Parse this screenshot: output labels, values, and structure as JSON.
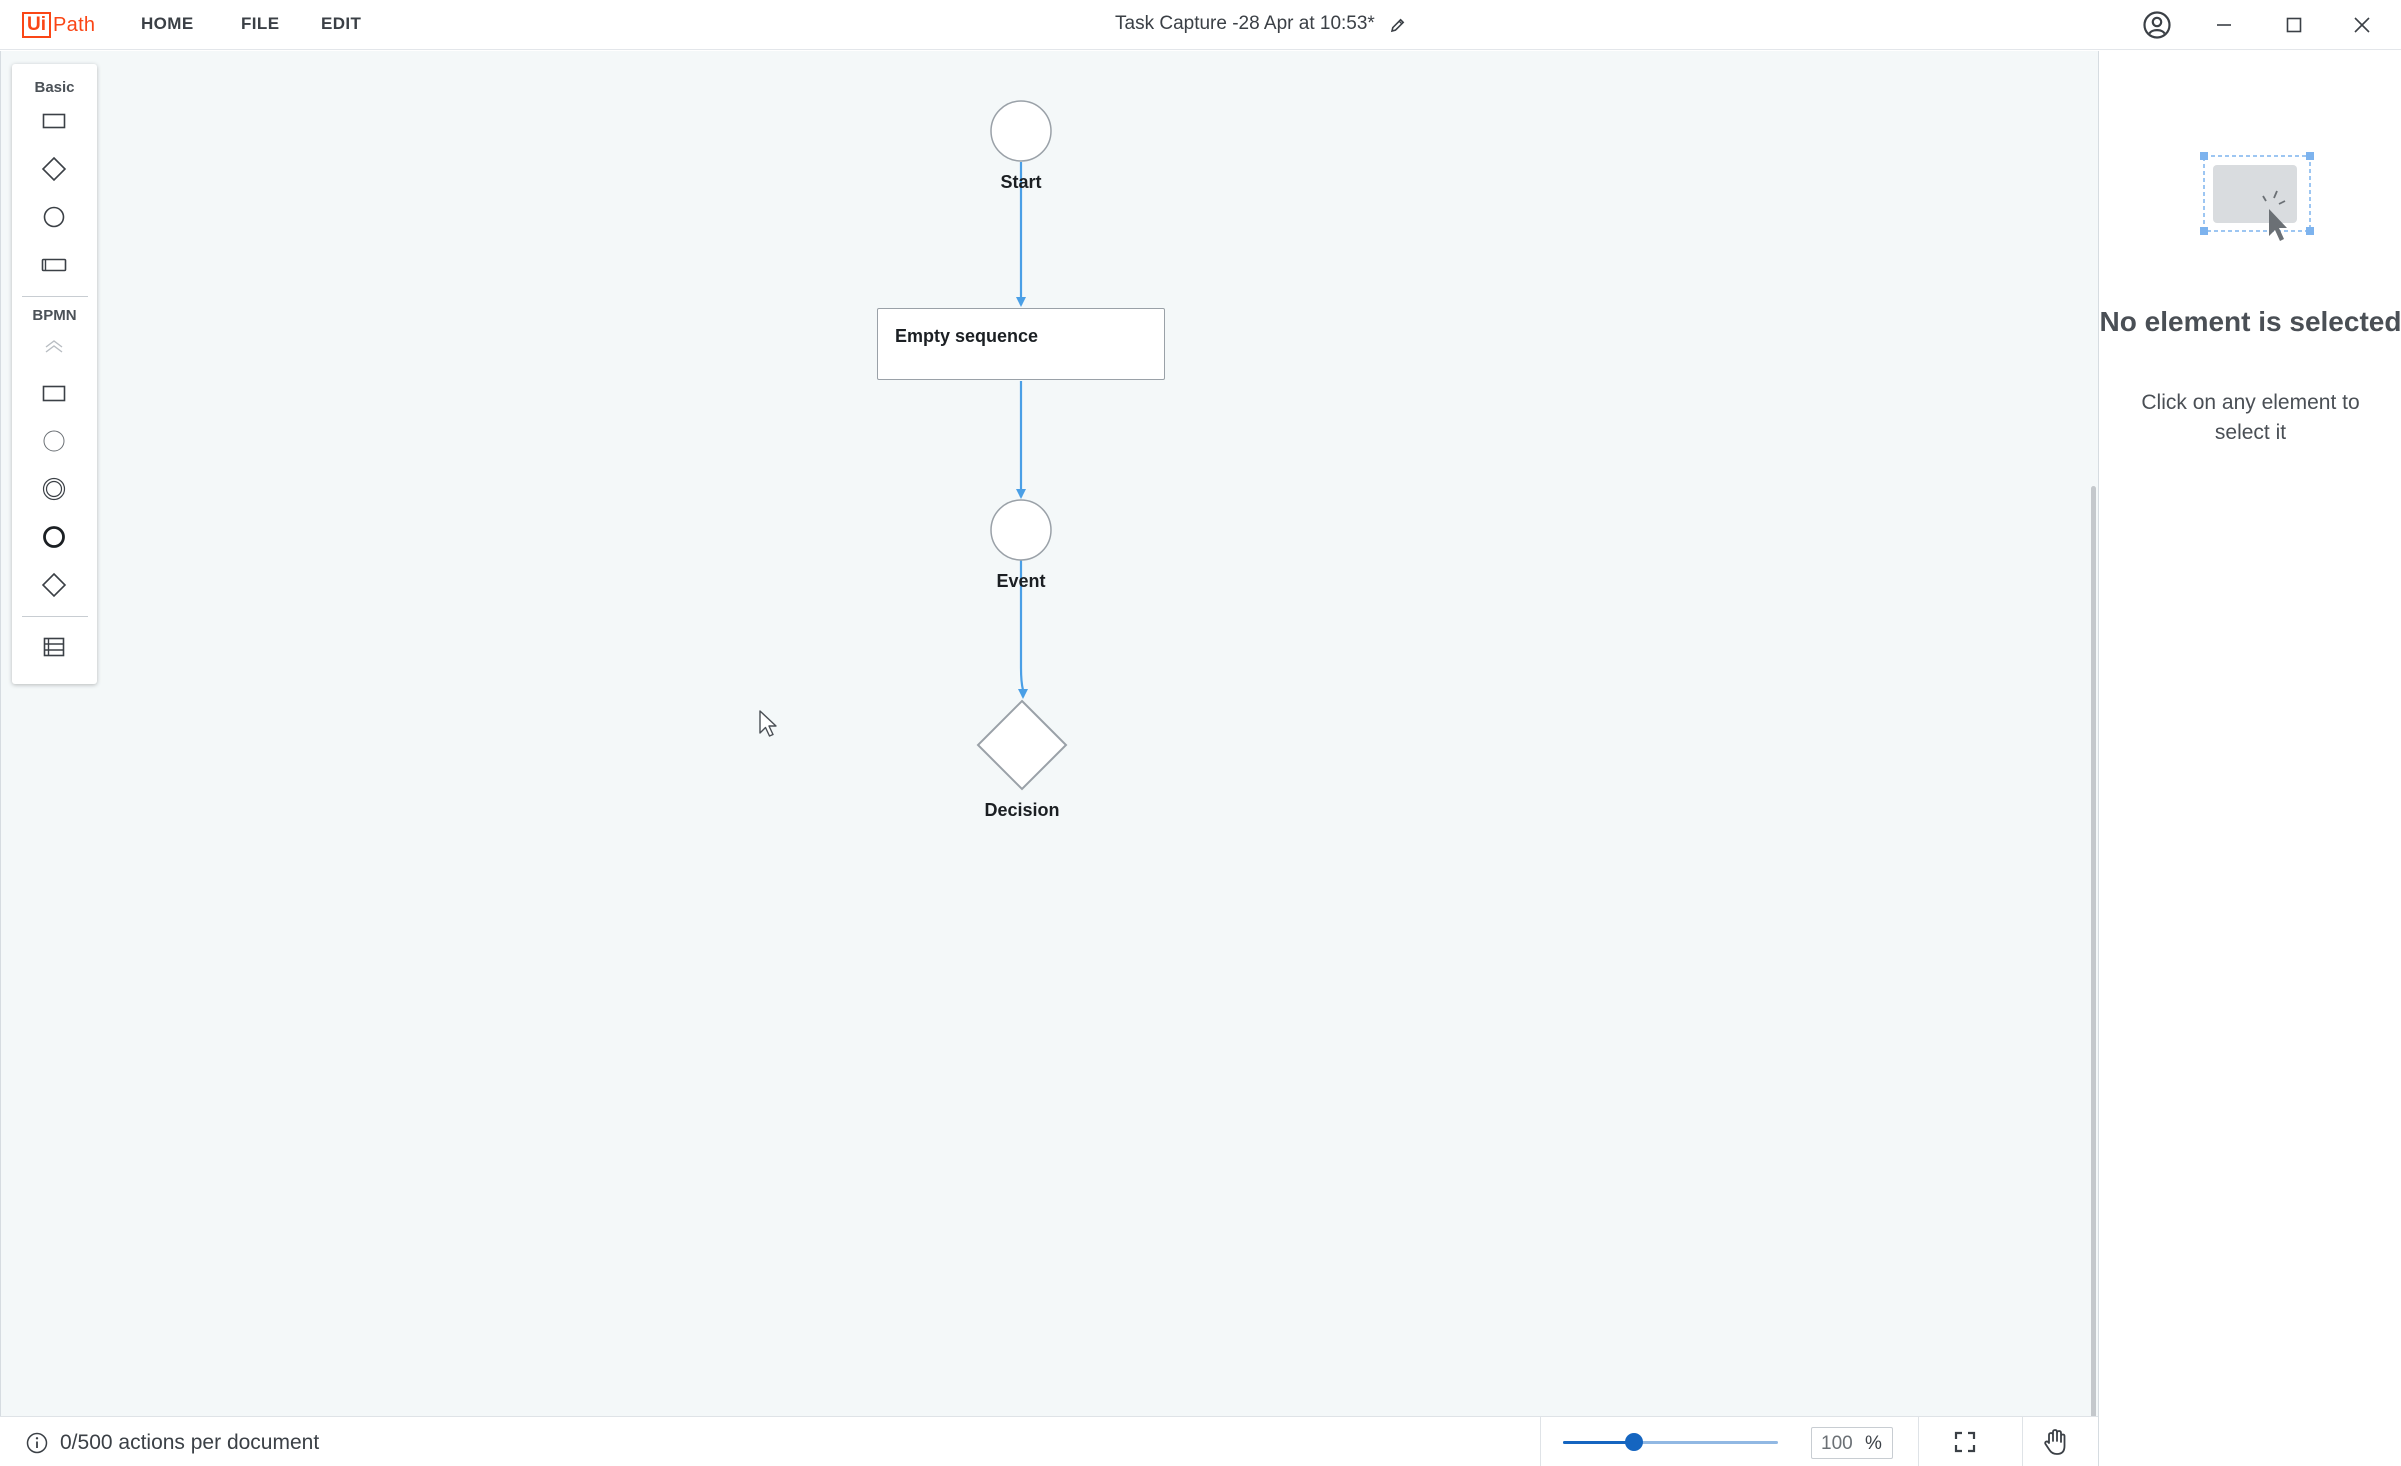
{
  "app": {
    "logo_ui": "Ui",
    "logo_path": "Path",
    "title": "Task Capture -28 Apr at 10:53*"
  },
  "menu": {
    "home": "HOME",
    "file": "FILE",
    "edit": "EDIT"
  },
  "palette": {
    "basic_heading": "Basic",
    "basic_items": [
      "rectangle-icon",
      "diamond-icon",
      "circle-icon",
      "rounded-rectangle-icon"
    ],
    "bpmn_heading": "BPMN",
    "bpmn_items": [
      "collapse-chevron-icon",
      "task-icon",
      "start-event-icon",
      "intermediate-event-icon",
      "end-event-icon",
      "gateway-icon"
    ],
    "extra_items": [
      "lane-icon"
    ]
  },
  "diagram": {
    "nodes": [
      {
        "id": "start",
        "type": "start-event",
        "label": "Start"
      },
      {
        "id": "seq",
        "type": "sequence",
        "label": "Empty sequence"
      },
      {
        "id": "event",
        "type": "intermediate-event",
        "label": "Event"
      },
      {
        "id": "decision",
        "type": "decision",
        "label": "Decision"
      }
    ],
    "connector_color": "#4a9fe6"
  },
  "right_panel": {
    "title": "No element is selected",
    "hint": "Click on any element to select it"
  },
  "status": {
    "actions": "0/500 actions per document"
  },
  "zoom": {
    "value": "100",
    "unit": "%",
    "level_fraction": 0.33
  },
  "colors": {
    "brand": "#fa4616",
    "accent": "#1565c0",
    "canvas_bg": "#f4f8f9",
    "connector": "#4a9fe6"
  }
}
